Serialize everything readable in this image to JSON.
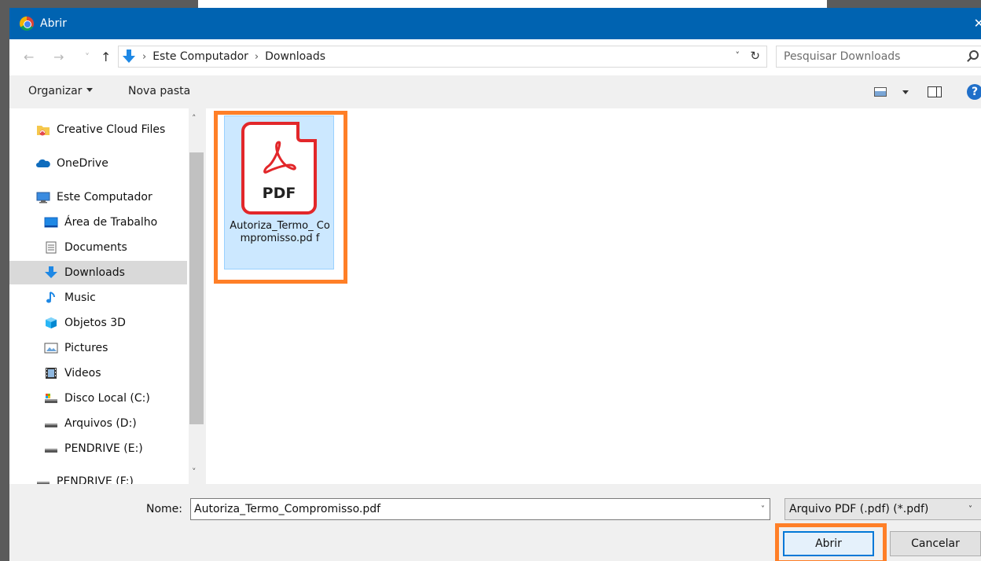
{
  "window": {
    "title": "Abrir",
    "close_glyph": "✕"
  },
  "address": {
    "back_glyph": "←",
    "forward_glyph": "→",
    "recent_glyph": "˅",
    "up_glyph": "↑",
    "separator": "›",
    "crumbs": [
      "Este Computador",
      "Downloads"
    ],
    "dropdown_glyph": "˅",
    "refresh_glyph": "↻"
  },
  "search": {
    "placeholder": "Pesquisar Downloads"
  },
  "toolbar": {
    "organize_label": "Organizar",
    "new_folder_label": "Nova pasta",
    "help_label": "?"
  },
  "nav": {
    "scroll_up": "˄",
    "scroll_down": "˅",
    "items": [
      {
        "label": "Creative Cloud Files",
        "icon": "creative-cloud-folder-icon"
      },
      {
        "label": "OneDrive",
        "icon": "onedrive-icon"
      },
      {
        "label": "Este Computador",
        "icon": "computer-icon"
      },
      {
        "label": "Área de Trabalho",
        "icon": "desktop-icon"
      },
      {
        "label": "Documents",
        "icon": "documents-icon"
      },
      {
        "label": "Downloads",
        "icon": "downloads-icon",
        "selected": true
      },
      {
        "label": "Music",
        "icon": "music-icon"
      },
      {
        "label": "Objetos 3D",
        "icon": "objects-3d-icon"
      },
      {
        "label": "Pictures",
        "icon": "pictures-icon"
      },
      {
        "label": "Videos",
        "icon": "videos-icon"
      },
      {
        "label": "Disco Local (C:)",
        "icon": "local-disk-icon"
      },
      {
        "label": "Arquivos (D:)",
        "icon": "drive-icon"
      },
      {
        "label": "PENDRIVE (E:)",
        "icon": "usb-drive-icon"
      },
      {
        "label": "PENDRIVE (F:)",
        "icon": "usb-drive-icon"
      }
    ]
  },
  "files": [
    {
      "name": "Autoriza_Termo_Compromisso.pdf",
      "name_display": "Autoriza_Termo_ Compromisso.pd f",
      "icon_text": "PDF",
      "selected": true
    }
  ],
  "bottom": {
    "name_label": "Nome:",
    "name_value": "Autoriza_Termo_Compromisso.pdf",
    "name_dropdown_glyph": "˅",
    "filter_value": "Arquivo PDF (.pdf) (*.pdf)",
    "filter_dropdown_glyph": "˅",
    "open_label": "Abrir",
    "cancel_label": "Cancelar"
  },
  "colors": {
    "titlebar": "#0063b1",
    "highlight": "#ff7f27",
    "pdf_red": "#e2272a",
    "selection": "#cce8ff"
  }
}
